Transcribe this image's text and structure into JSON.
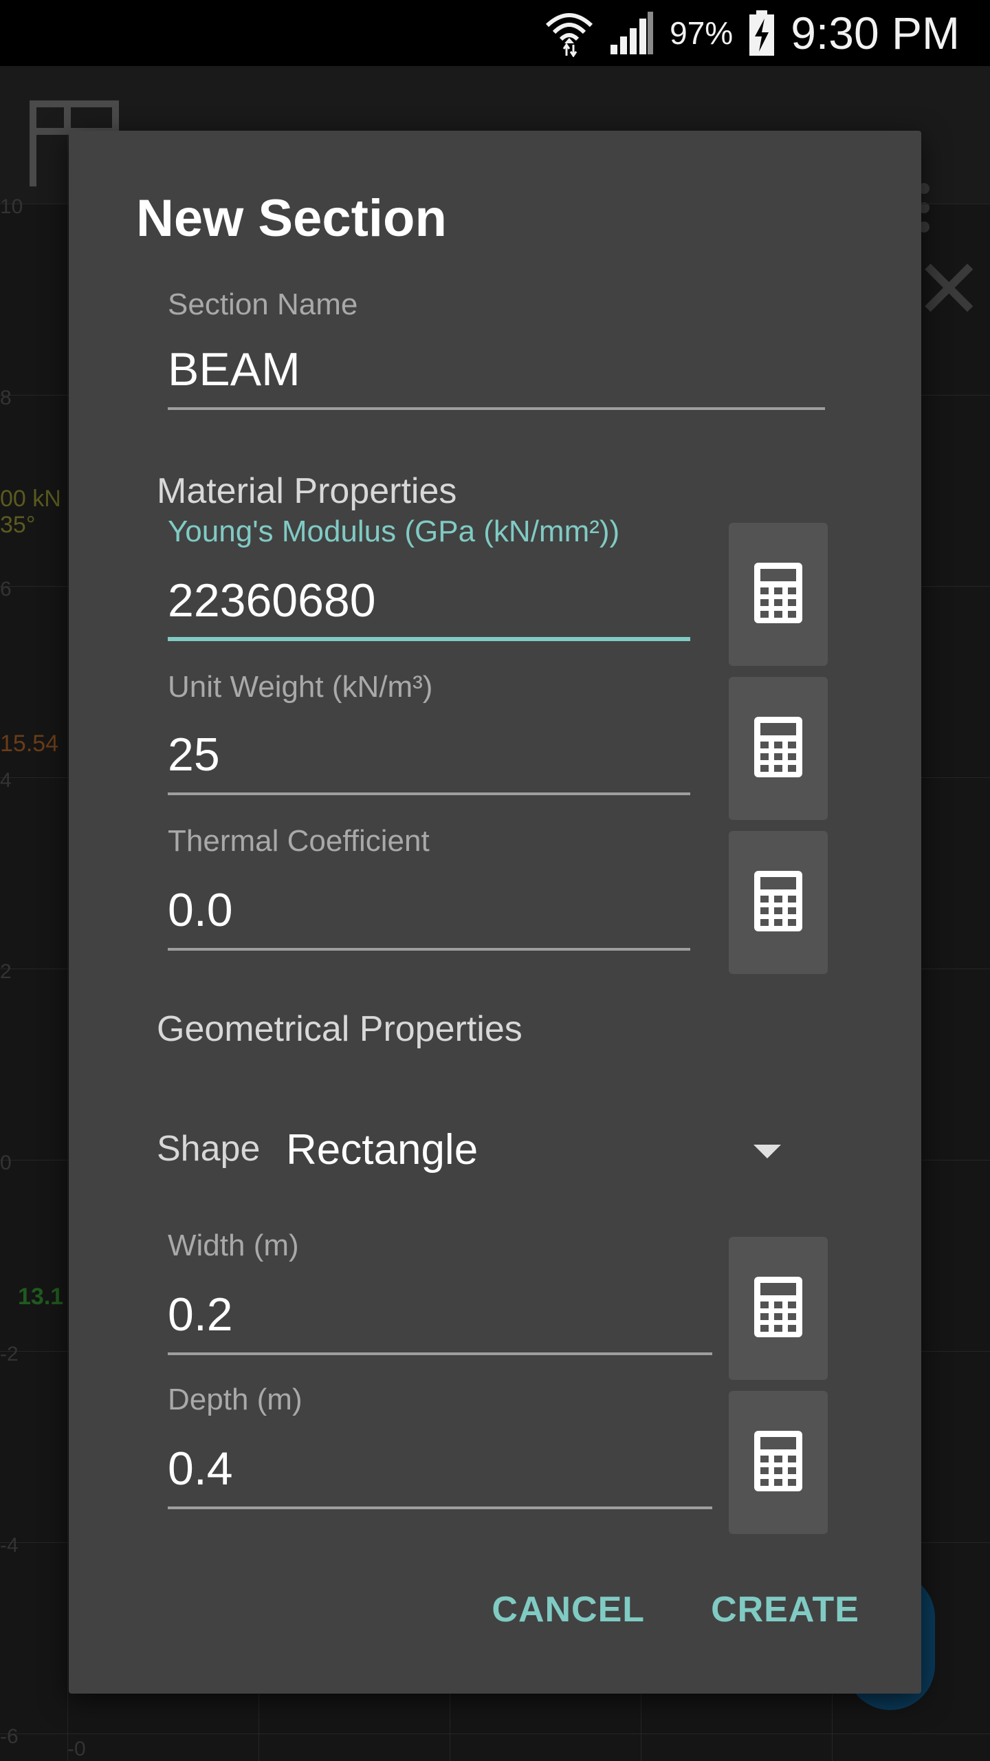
{
  "status_bar": {
    "battery": "97%",
    "time": "9:30 PM"
  },
  "background": {
    "y_labels": [
      "10",
      "8",
      "6",
      "4",
      "2",
      "0",
      "-2",
      "-4",
      "-6"
    ],
    "x_label_origin": "-0",
    "load_label_top": "00 kN",
    "load_angle": "35°",
    "moment_label": "15.54",
    "reaction_label": "13.1"
  },
  "dialog": {
    "title": "New Section",
    "section_name": {
      "label": "Section Name",
      "value": "BEAM"
    },
    "material_heading": "Material Properties",
    "youngs_modulus": {
      "label": "Young's Modulus (GPa (kN/mm²))",
      "value": "22360680"
    },
    "unit_weight": {
      "label": "Unit Weight (kN/m³)",
      "value": "25"
    },
    "thermal_coefficient": {
      "label": "Thermal Coefficient",
      "value": "0.0"
    },
    "geometry_heading": "Geometrical Properties",
    "shape": {
      "label": "Shape",
      "value": "Rectangle"
    },
    "width": {
      "label": "Width (m)",
      "value": "0.2"
    },
    "depth": {
      "label": "Depth (m)",
      "value": "0.4"
    },
    "cancel_label": "CANCEL",
    "create_label": "CREATE"
  },
  "colors": {
    "accent": "#80cbc4",
    "dialog_bg": "#424242",
    "button_bg": "#535353"
  }
}
